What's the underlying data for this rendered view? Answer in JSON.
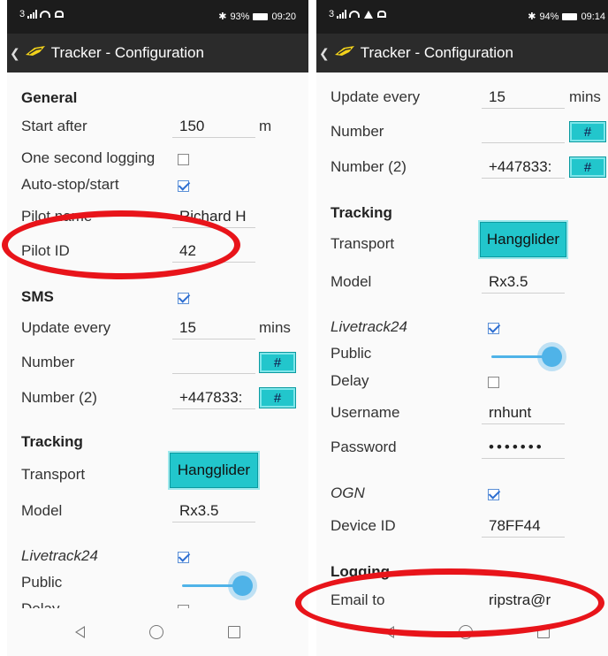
{
  "left": {
    "status": {
      "left_text": "3",
      "battery": "93%",
      "time": "09:20"
    },
    "app_title": "Tracker - Configuration",
    "general_header": "General",
    "start_after": {
      "label": "Start after",
      "value": "150",
      "unit": "m"
    },
    "one_second_logging": {
      "label": "One second logging",
      "checked": false
    },
    "auto_stop_start": {
      "label": "Auto-stop/start",
      "checked": true
    },
    "pilot_name": {
      "label": "Pilot name",
      "value": "Richard H"
    },
    "pilot_id": {
      "label": "Pilot ID",
      "value": "42"
    },
    "sms": {
      "label": "SMS",
      "checked": true
    },
    "update_every": {
      "label": "Update every",
      "value": "15",
      "unit": "mins"
    },
    "number": {
      "label": "Number",
      "value": "",
      "hash": "#"
    },
    "number2": {
      "label": "Number (2)",
      "value": "+447833:",
      "hash": "#"
    },
    "tracking_header": "Tracking",
    "transport": {
      "label": "Transport",
      "button": "Hangglider"
    },
    "model": {
      "label": "Model",
      "value": "Rx3.5"
    },
    "livetrack24": {
      "label": "Livetrack24",
      "checked": true
    },
    "public": {
      "label": "Public",
      "level": 1.0
    },
    "delay": {
      "label": "Delay",
      "checked": false
    }
  },
  "right": {
    "status": {
      "left_text": "3",
      "battery": "94%",
      "time": "09:14"
    },
    "app_title": "Tracker - Configuration",
    "update_every": {
      "label": "Update every",
      "value": "15",
      "unit": "mins"
    },
    "number": {
      "label": "Number",
      "value": "",
      "hash": "#"
    },
    "number2": {
      "label": "Number (2)",
      "value": "+447833:",
      "hash": "#"
    },
    "tracking_header": "Tracking",
    "transport": {
      "label": "Transport",
      "button": "Hangglider"
    },
    "model": {
      "label": "Model",
      "value": "Rx3.5"
    },
    "livetrack24": {
      "label": "Livetrack24",
      "checked": true
    },
    "public": {
      "label": "Public",
      "level": 1.0
    },
    "delay": {
      "label": "Delay",
      "checked": false
    },
    "username": {
      "label": "Username",
      "value": "rnhunt"
    },
    "password": {
      "label": "Password",
      "value": "•••••••"
    },
    "ogn": {
      "label": "OGN",
      "checked": true
    },
    "device_id": {
      "label": "Device ID",
      "value": "78FF44"
    },
    "logging_header": "Logging",
    "email_to": {
      "label": "Email to",
      "value": "ripstra@r"
    }
  },
  "colors": {
    "accent": "#22c6cc",
    "highlight_oval": "#e8141a",
    "slider": "#4fb3e8",
    "appbar": "#2b2b2b"
  }
}
